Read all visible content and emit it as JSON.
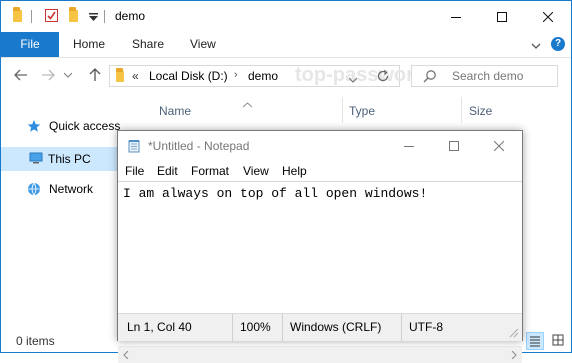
{
  "explorer": {
    "title": "demo",
    "ribbon": {
      "file": "File",
      "tabs": [
        "Home",
        "Share",
        "View"
      ]
    },
    "address": {
      "segments": [
        "Local Disk (D:)",
        "demo"
      ],
      "overflow": "«"
    },
    "search": {
      "placeholder": "Search demo"
    },
    "watermark": "top-password.com",
    "columns": [
      "Name",
      "Type",
      "Size"
    ],
    "nav_pane": [
      {
        "label": "Quick access",
        "icon": "star-icon"
      },
      {
        "label": "This PC",
        "icon": "computer-icon"
      },
      {
        "label": "Network",
        "icon": "network-icon"
      }
    ],
    "status": {
      "items_count": "0 items"
    }
  },
  "notepad": {
    "title": "*Untitled - Notepad",
    "menu": [
      "File",
      "Edit",
      "Format",
      "View",
      "Help"
    ],
    "content": "I am always on top of all open windows!",
    "status": {
      "position": "Ln 1, Col 40",
      "zoom": "100%",
      "line_endings": "Windows (CRLF)",
      "encoding": "UTF-8"
    }
  },
  "colors": {
    "accent": "#1979ca",
    "selected": "#cce8ff"
  }
}
